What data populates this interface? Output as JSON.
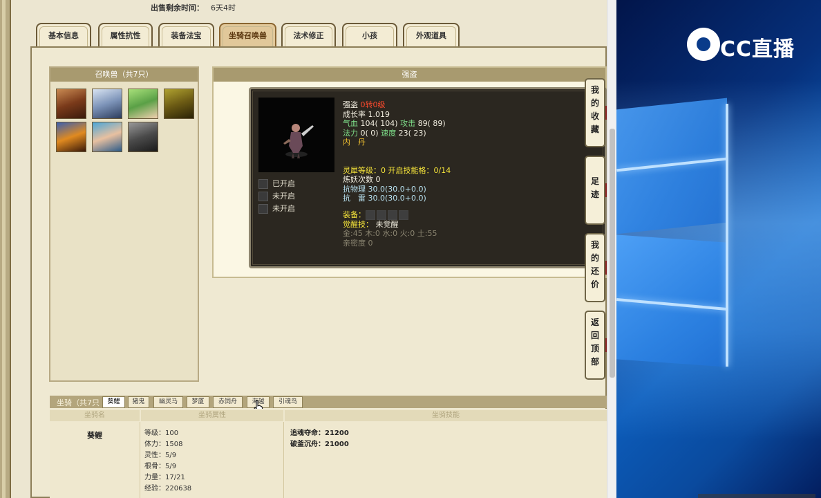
{
  "sale_time": {
    "label": "出售剩余时间：",
    "value": "6天4时"
  },
  "tabs": [
    {
      "label": "基本信息",
      "active": false
    },
    {
      "label": "属性抗性",
      "active": false
    },
    {
      "label": "装备法宝",
      "active": false
    },
    {
      "label": "坐骑召唤兽",
      "active": true
    },
    {
      "label": "法术修正",
      "active": false
    },
    {
      "label": "小孩",
      "active": false
    },
    {
      "label": "外观道具",
      "active": false
    }
  ],
  "summon_panel": {
    "title": "召唤兽（共7只）"
  },
  "detail": {
    "title": "强盗",
    "name": "强盗",
    "level": "0转0级",
    "growth": "成长率 1.019",
    "hp_label": "气血",
    "hp": "104( 104)",
    "atk_label": "攻击",
    "atk": "89( 89)",
    "mp_label": "法力",
    "mp": "0( 0)",
    "spd_label": "速度",
    "spd": "23( 23)",
    "neidan": "内　丹",
    "spirit": "灵犀等级：0 开启技能格：0/14",
    "refine": "炼妖次数 0",
    "res_phys": "抗物理 30.0(30.0+0.0)",
    "res_thunder": "抗　雷 30.0(30.0+0.0)",
    "equip_label": "装备：",
    "awaken_label": "觉醒技：",
    "awaken_value": "未觉醒",
    "elements": "金:45 木:0 水:0 火:0 土:55",
    "intimacy": "亲密度 0",
    "skill_states": [
      "已开启",
      "未开启",
      "未开启"
    ]
  },
  "side_buttons": [
    {
      "label": "我的收藏"
    },
    {
      "label": "足迹"
    },
    {
      "label": "我的还价"
    },
    {
      "label": "返回顶部"
    }
  ],
  "mount": {
    "title": "坐骑（共7只",
    "tabs": [
      "葵鲤",
      "猪鬼",
      "幽灵马",
      "梦厦",
      "赤饲舟",
      "海越",
      "引魂鸟"
    ],
    "active_tab": "葵鲤",
    "headers": [
      "坐骑名",
      "坐骑属性",
      "坐骑技能"
    ],
    "name": "葵鲤",
    "attrs": [
      "等级：100",
      "体力：1508",
      "灵性：5/9",
      "根骨：5/9",
      "力量：17/21",
      "经验：220638"
    ],
    "skills": [
      "追魂夺命：21200",
      "破釜沉舟：21000"
    ]
  },
  "desktop": {
    "brand": "CC直播"
  }
}
